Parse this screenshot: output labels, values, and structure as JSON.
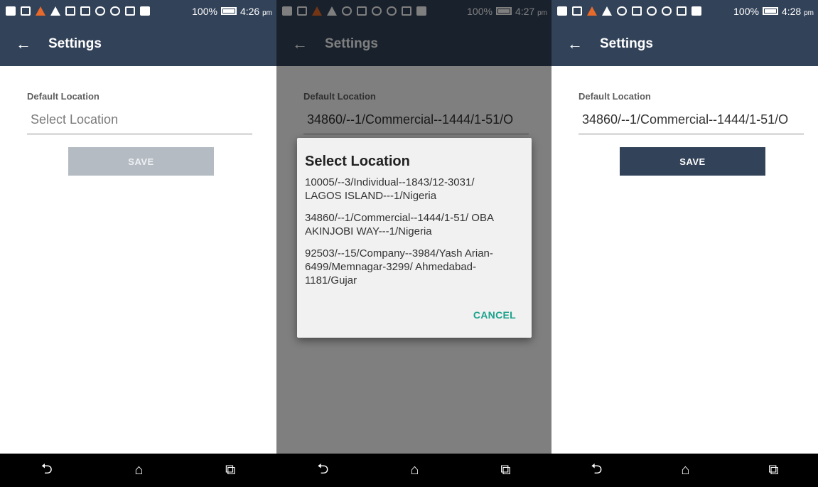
{
  "screens": [
    {
      "status": {
        "battery": "100%",
        "time": "4:26",
        "ampm": "pm"
      },
      "appbar": {
        "back_icon": "←",
        "title": "Settings"
      },
      "form": {
        "label": "Default Location",
        "value": "",
        "placeholder": "Select Location",
        "save_label": "SAVE",
        "save_enabled": false
      },
      "nav": {
        "back": "⮌",
        "home": "⌂",
        "recents": "⧉"
      }
    },
    {
      "status": {
        "battery": "100%",
        "time": "4:27",
        "ampm": "pm"
      },
      "appbar": {
        "back_icon": "←",
        "title": "Settings"
      },
      "form": {
        "label": "Default Location",
        "value": "34860/--1/Commercial--1444/1-51/O"
      },
      "dialog": {
        "title": "Select Location",
        "options": [
          "10005/--3/Individual--1843/12-3031/ LAGOS ISLAND---1/Nigeria",
          "34860/--1/Commercial--1444/1-51/ OBA AKINJOBI WAY---1/Nigeria",
          "92503/--15/Company--3984/Yash Arian-6499/Memnagar-3299/ Ahmedabad-1181/Gujar"
        ],
        "cancel_label": "CANCEL"
      },
      "nav": {
        "back": "⮌",
        "home": "⌂",
        "recents": "⧉"
      }
    },
    {
      "status": {
        "battery": "100%",
        "time": "4:28",
        "ampm": "pm"
      },
      "appbar": {
        "back_icon": "←",
        "title": "Settings"
      },
      "form": {
        "label": "Default Location",
        "value": "34860/--1/Commercial--1444/1-51/O",
        "save_label": "SAVE",
        "save_enabled": true
      },
      "nav": {
        "back": "⮌",
        "home": "⌂",
        "recents": "⧉"
      }
    }
  ],
  "colors": {
    "appbar": "#324258",
    "save_enabled": "#324258",
    "save_disabled": "#b4bbc3",
    "dialog_action": "#1aa28c"
  }
}
